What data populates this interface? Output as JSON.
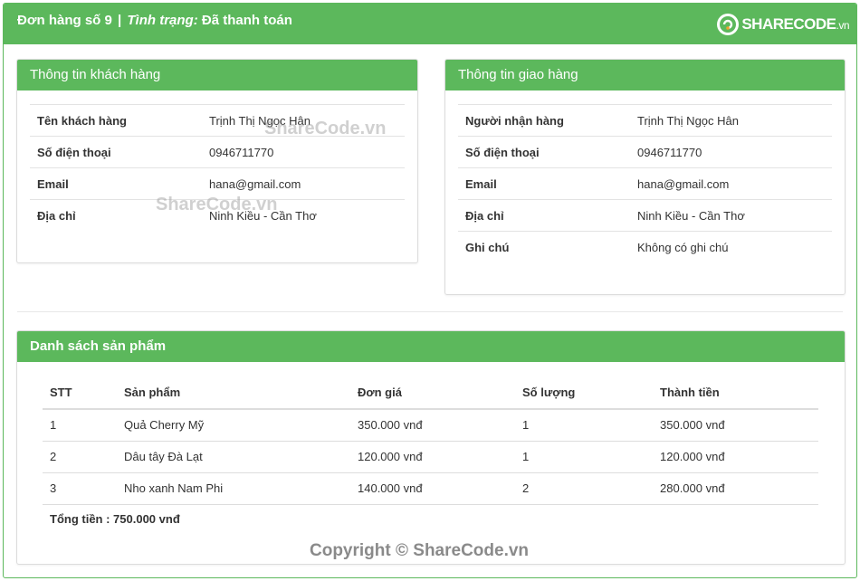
{
  "header": {
    "order_label": "Đơn hàng số 9",
    "separator": "|",
    "status_label": "Tình trạng:",
    "status_value": "Đã thanh toán"
  },
  "logo": {
    "share": "SHARE",
    "code": "CODE",
    "domain": ".vn"
  },
  "customer_panel": {
    "title": "Thông tin khách hàng",
    "rows": [
      {
        "label": "Tên khách hàng",
        "value": "Trịnh Thị Ngọc Hân"
      },
      {
        "label": "Số điện thoại",
        "value": "0946711770"
      },
      {
        "label": "Email",
        "value": "hana@gmail.com"
      },
      {
        "label": "Địa chỉ",
        "value": "Ninh Kiều - Cần Thơ"
      }
    ]
  },
  "shipping_panel": {
    "title": "Thông tin giao hàng",
    "rows": [
      {
        "label": "Người nhận hàng",
        "value": "Trịnh Thị Ngọc Hân"
      },
      {
        "label": "Số điện thoại",
        "value": "0946711770"
      },
      {
        "label": "Email",
        "value": "hana@gmail.com"
      },
      {
        "label": "Địa chỉ",
        "value": "Ninh Kiều - Cần Thơ"
      },
      {
        "label": "Ghi chú",
        "value": "Không có ghi chú"
      }
    ]
  },
  "products_panel": {
    "title": "Danh sách sản phẩm",
    "columns": [
      "STT",
      "Sản phẩm",
      "Đơn giá",
      "Số lượng",
      "Thành tiền"
    ],
    "rows": [
      {
        "stt": "1",
        "name": "Quả Cherry Mỹ",
        "price": "350.000 vnđ",
        "qty": "1",
        "total": "350.000 vnđ"
      },
      {
        "stt": "2",
        "name": "Dâu tây Đà Lạt",
        "price": "120.000 vnđ",
        "qty": "1",
        "total": "120.000 vnđ"
      },
      {
        "stt": "3",
        "name": "Nho xanh Nam Phi",
        "price": "140.000 vnđ",
        "qty": "2",
        "total": "280.000 vnđ"
      }
    ],
    "total_text": "Tổng tiền : 750.000 vnđ"
  },
  "watermarks": {
    "mark1": "ShareCode.vn",
    "mark2": "ShareCode.vn"
  },
  "footer": {
    "copyright": "Copyright © ShareCode.vn"
  },
  "colors": {
    "primary_green": "#5cb85c",
    "border": "#dcdcdc"
  }
}
